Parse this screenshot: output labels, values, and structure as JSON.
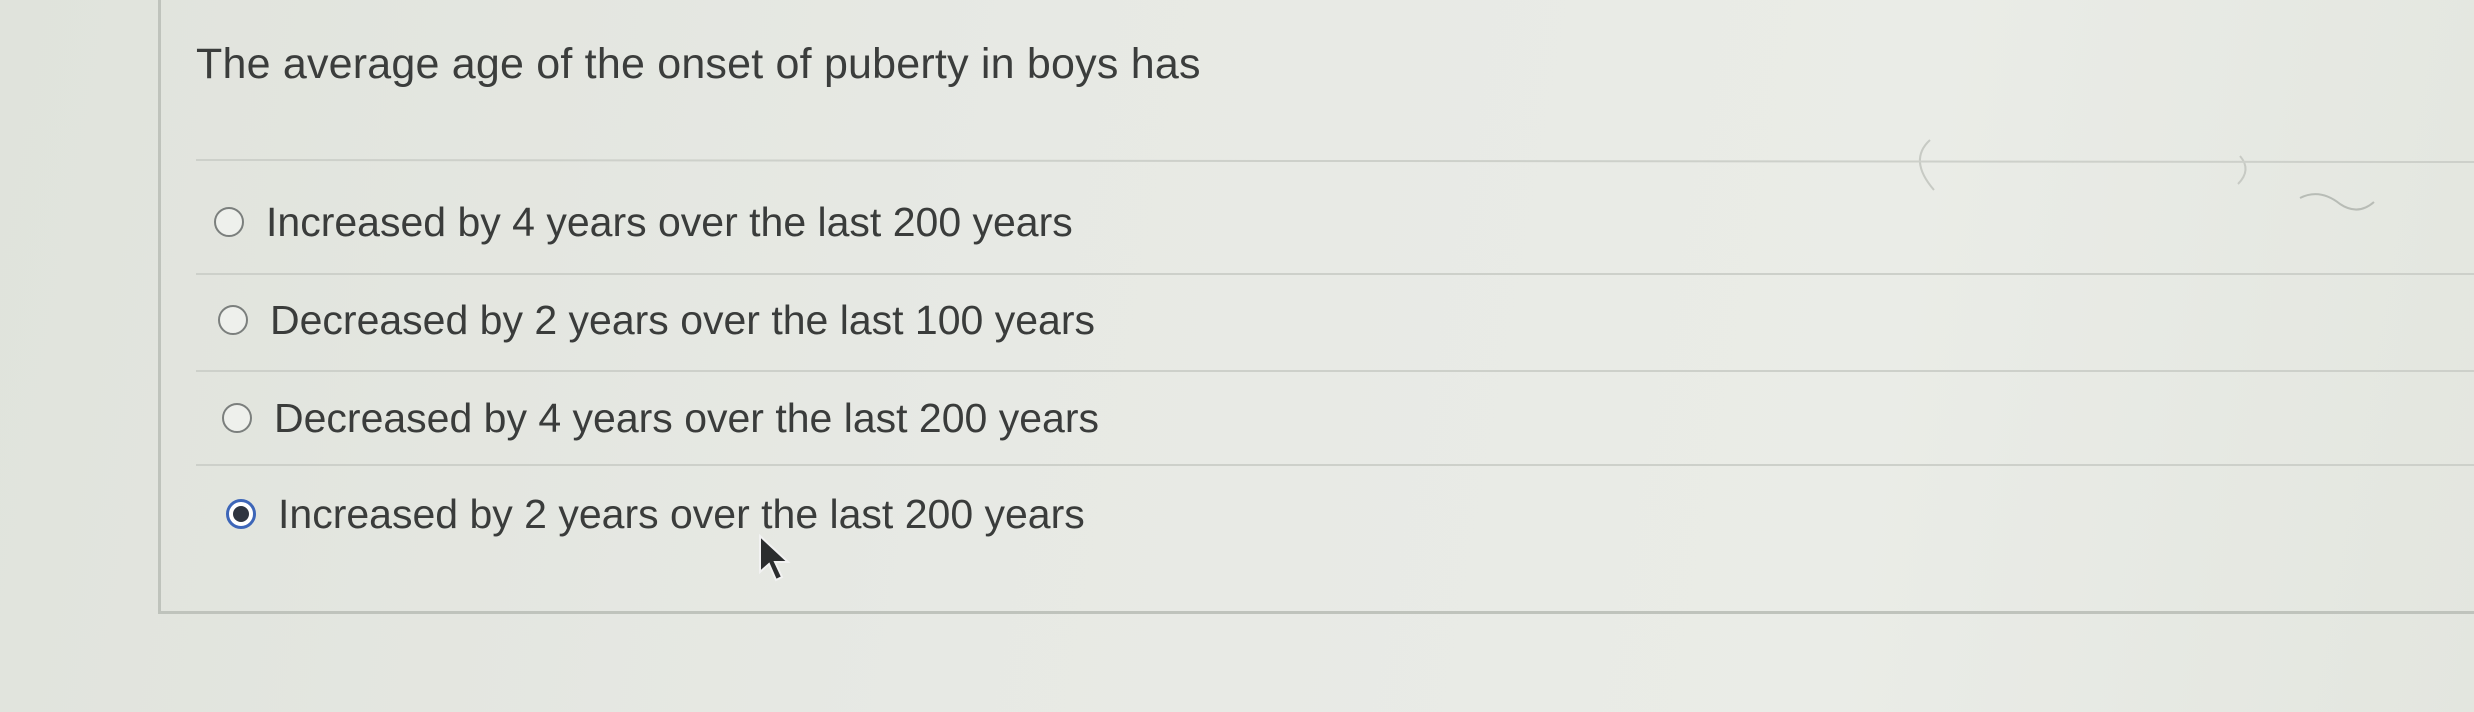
{
  "question": {
    "prompt": "The average age of the onset of puberty in boys has"
  },
  "options": [
    {
      "label": "Increased by 4 years over the last 200 years",
      "selected": false
    },
    {
      "label": "Decreased by 2 years over the last 100 years",
      "selected": false
    },
    {
      "label": "Decreased by 4 years over the last 200 years",
      "selected": false
    },
    {
      "label": "Increased by 2 years over the last 200 years",
      "selected": true
    }
  ],
  "colors": {
    "radio_selected_ring": "#3d66b8",
    "radio_selected_dot": "#2e3440",
    "text": "#3a3c3b",
    "background": "#e6e8e2"
  },
  "icons": {
    "cursor": "mouse-pointer-icon",
    "radio_unchecked": "radio-unchecked-icon",
    "radio_checked": "radio-checked-icon"
  }
}
